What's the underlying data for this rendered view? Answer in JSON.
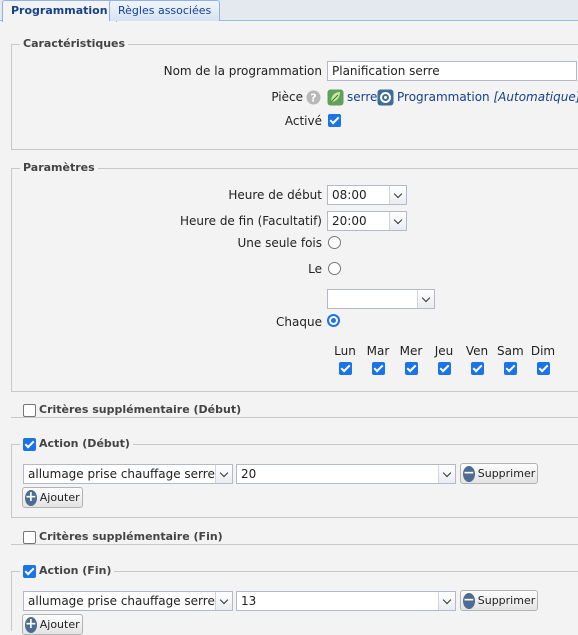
{
  "tabs": [
    {
      "label": "Programmation",
      "active": true
    },
    {
      "label": "Règles associées",
      "active": false
    }
  ],
  "caracteristiques": {
    "legend": "Caractéristiques",
    "name_label": "Nom de la programmation",
    "name_value": "Planification serre",
    "piece_label": "Pièce",
    "help_icon": "question-circle-icon",
    "piece_value": "serre",
    "piece_icon": "leaf-icon",
    "mode_icon": "gear-icon",
    "mode_name": "Programmation",
    "mode_type": "[Automatique]",
    "active_label": "Activé",
    "active_checked": true
  },
  "parametres": {
    "legend": "Paramètres",
    "start_label": "Heure de début",
    "start_value": "08:00",
    "end_label": "Heure de fin (Facultatif)",
    "end_value": "20:00",
    "once_label": "Une seule fois",
    "le_label": "Le",
    "le_value": "",
    "chaque_label": "Chaque",
    "days": [
      {
        "label": "Lun",
        "checked": true
      },
      {
        "label": "Mar",
        "checked": true
      },
      {
        "label": "Mer",
        "checked": true
      },
      {
        "label": "Jeu",
        "checked": true
      },
      {
        "label": "Ven",
        "checked": true
      },
      {
        "label": "Sam",
        "checked": true
      },
      {
        "label": "Dim",
        "checked": true
      }
    ]
  },
  "criteres_debut": {
    "legend": "Critères supplémentaire (Début)",
    "checked": false
  },
  "action_debut": {
    "legend": "Action (Début)",
    "checked": true,
    "device": "allumage prise chauffage serre",
    "value": "20",
    "remove_label": "Supprimer",
    "add_label": "Ajouter"
  },
  "criteres_fin": {
    "legend": "Critères supplémentaire (Fin)",
    "checked": false
  },
  "action_fin": {
    "legend": "Action (Fin)",
    "checked": true,
    "device": "allumage prise chauffage serre",
    "value": "13",
    "remove_label": "Supprimer",
    "add_label": "Ajouter"
  },
  "colors": {
    "accent": "#1a73e8",
    "tab_text": "#15428b",
    "link": "#15428b"
  }
}
